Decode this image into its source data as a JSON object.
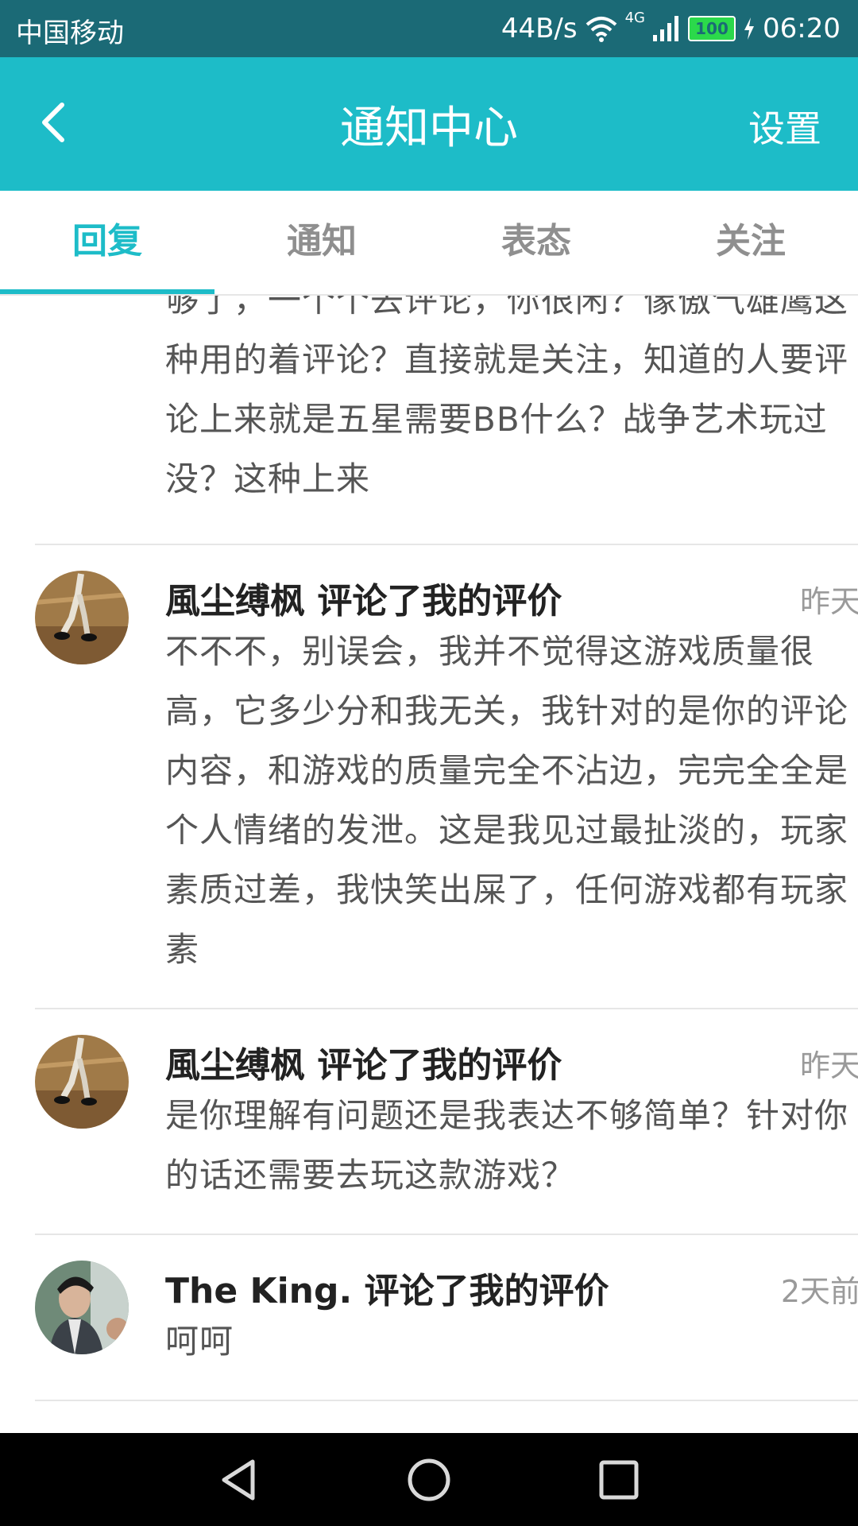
{
  "status_bar": {
    "carrier": "中国移动",
    "speed": "44B/s",
    "network": "4G",
    "battery": "100",
    "time": "06:20"
  },
  "header": {
    "title": "通知中心",
    "settings_label": "设置",
    "back_icon": "chevron-left-icon"
  },
  "tabs": [
    {
      "label": "回复",
      "active": true
    },
    {
      "label": "通知",
      "active": false
    },
    {
      "label": "表态",
      "active": false
    },
    {
      "label": "关注",
      "active": false
    }
  ],
  "colors": {
    "accent": "#1dbcc8",
    "status_bar": "#1b6a76"
  },
  "notifications": [
    {
      "partial": true,
      "text": "够了，一个个去评论，你很闲？像傲气雄鹰这种用的着评论？直接就是关注，知道的人要评论上来就是五星需要BB什么？战争艺术玩过没？这种上来"
    },
    {
      "title": "風尘缚枫 评论了我的评价",
      "time": "昨天",
      "text": "不不不，别误会，我并不觉得这游戏质量很高，它多少分和我无关，我针对的是你的评论内容，和游戏的质量完全不沾边，完完全全是个人情绪的发泄。这是我见过最扯淡的，玩家素质过差，我快笑出屎了，任何游戏都有玩家素"
    },
    {
      "title": "風尘缚枫 评论了我的评价",
      "time": "昨天",
      "text": "是你理解有问题还是我表达不够简单？针对你的话还需要去玩这款游戏？"
    },
    {
      "title": "The King. 评论了我的评价",
      "time": "2天前",
      "text": "呵呵"
    }
  ],
  "system_nav": [
    "back-triangle-icon",
    "home-circle-icon",
    "recents-square-icon"
  ]
}
